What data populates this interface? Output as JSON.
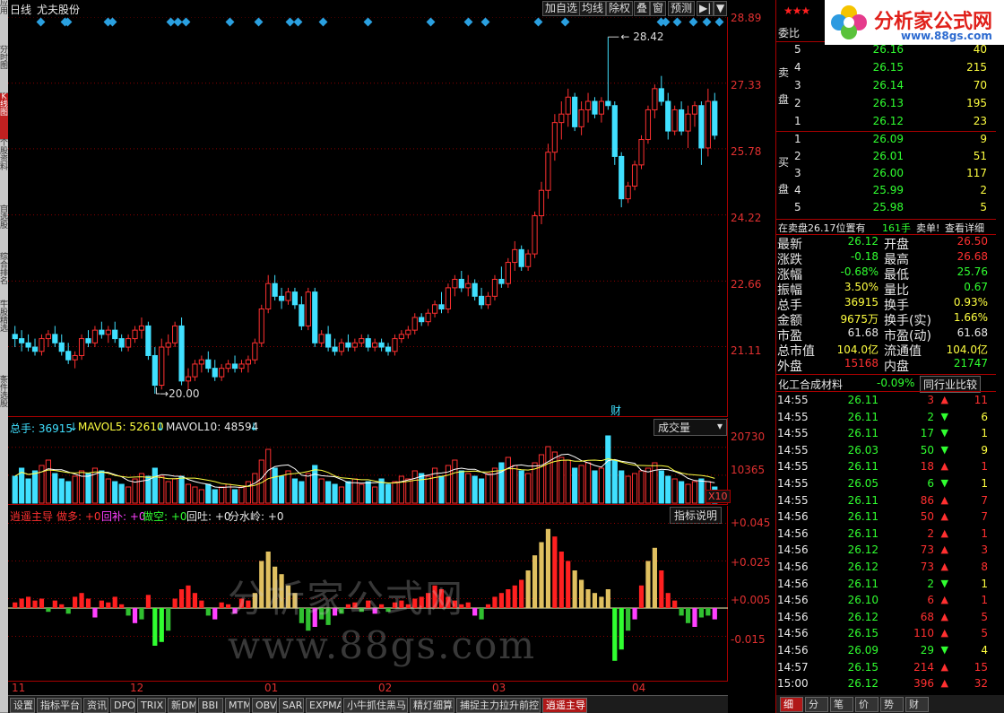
{
  "stock": {
    "period": "日线",
    "name": "尤夫股份"
  },
  "toolbar": {
    "add_fav": "加自选",
    "ma": "均线",
    "exright": "除权",
    "overlay": "叠",
    "window": "窗",
    "forecast": "预测"
  },
  "main": {
    "high_label": "28.42",
    "low_label": "20.00",
    "cai_label": "财",
    "yaxis": [
      "28.89",
      "27.33",
      "25.78",
      "24.22",
      "22.66",
      "21.11"
    ]
  },
  "volume": {
    "header_total": "总手: 36915",
    "header_ma5": "MAVOL5: 52610",
    "header_ma10": "MAVOL10: 48594",
    "selector": "成交量",
    "yaxis": [
      "20730",
      "10365"
    ],
    "unit": "X10"
  },
  "indicator": {
    "name": "逍遥主导",
    "do_more": "做多: +0",
    "hui_bu": "回补: +0",
    "do_short": "做空: +0",
    "hui_tu": "回吐: +0",
    "fen_shui": "分水岭: +0",
    "help": "指标说明",
    "yaxis": [
      "+0.045",
      "+0.025",
      "+0.005",
      "-0.015"
    ]
  },
  "xaxis": [
    "11",
    "12",
    "01",
    "02",
    "03",
    "04"
  ],
  "watermark": "分析家公式网www.88gs.com",
  "tabs": [
    "设置",
    "指标平台",
    "资讯",
    "DPO",
    "TRIX",
    "新DMA",
    "BBI",
    "MTM",
    "OBV",
    "SAR",
    "EXPMA",
    "小牛抓住黑马",
    "精灯细算",
    "捕捉主力拉升前控",
    "逍遥主导"
  ],
  "activeTab": "逍遥主导",
  "leftTabs": [
    "应用",
    "分时图",
    "K线图",
    "个股资料",
    "自选股",
    "综合排名",
    "牛股精选",
    "条件选股"
  ],
  "logo": {
    "text": "分析家公式网",
    "url": "www.88gs.com"
  },
  "orderbook": {
    "wei_bi": "委比",
    "sell_label": [
      "卖",
      "盘"
    ],
    "buy_label": [
      "买",
      "盘"
    ],
    "sells": [
      {
        "lvl": "5",
        "price": "26.16",
        "vol": "40"
      },
      {
        "lvl": "4",
        "price": "26.15",
        "vol": "215"
      },
      {
        "lvl": "3",
        "price": "26.14",
        "vol": "70"
      },
      {
        "lvl": "2",
        "price": "26.13",
        "vol": "195"
      },
      {
        "lvl": "1",
        "price": "26.12",
        "vol": "23"
      }
    ],
    "buys": [
      {
        "lvl": "1",
        "price": "26.09",
        "vol": "9"
      },
      {
        "lvl": "2",
        "price": "26.01",
        "vol": "51"
      },
      {
        "lvl": "3",
        "price": "26.00",
        "vol": "117"
      },
      {
        "lvl": "4",
        "price": "25.99",
        "vol": "2"
      },
      {
        "lvl": "5",
        "price": "25.98",
        "vol": "5"
      }
    ],
    "notice": "在卖盘26.17位置有",
    "notice_vol": "161手",
    "notice_sell": "卖单!",
    "notice_detail": "查看详细"
  },
  "quote": [
    {
      "l": "最新",
      "v": "26.12",
      "lc": "green",
      "r": "开盘",
      "rv": "26.50",
      "rc": "red"
    },
    {
      "l": "涨跌",
      "v": "-0.18",
      "lc": "green",
      "r": "最高",
      "rv": "26.68",
      "rc": "red"
    },
    {
      "l": "涨幅",
      "v": "-0.68%",
      "lc": "green",
      "r": "最低",
      "rv": "25.76",
      "rc": "green"
    },
    {
      "l": "振幅",
      "v": "3.50%",
      "lc": "yellow",
      "r": "量比",
      "rv": "0.67",
      "rc": "green"
    },
    {
      "l": "总手",
      "v": "36915",
      "lc": "yellow",
      "r": "换手",
      "rv": "0.93%",
      "rc": "yellow"
    },
    {
      "l": "金额",
      "v": "9675万",
      "lc": "yellow",
      "r": "换手(实)",
      "rv": "1.66%",
      "rc": "yellow"
    },
    {
      "l": "市盈",
      "v": "61.68",
      "lc": "white",
      "r": "市盈(动)",
      "rv": "61.68",
      "rc": "white"
    },
    {
      "l": "总市值",
      "v": "104.0亿",
      "lc": "yellow",
      "r": "流通值",
      "rv": "104.0亿",
      "rc": "yellow"
    },
    {
      "l": "外盘",
      "v": "15168",
      "lc": "red",
      "r": "内盘",
      "rv": "21747",
      "rc": "green"
    }
  ],
  "industry": {
    "name": "化工合成材料",
    "change": "-0.09%",
    "compare": "同行业比较"
  },
  "ticks": [
    {
      "t": "14:55",
      "p": "26.11",
      "v": "3",
      "d": "up",
      "x": "11"
    },
    {
      "t": "14:55",
      "p": "26.11",
      "v": "2",
      "d": "down",
      "x": "6"
    },
    {
      "t": "14:55",
      "p": "26.11",
      "v": "17",
      "d": "down",
      "x": "1"
    },
    {
      "t": "14:55",
      "p": "26.03",
      "v": "50",
      "d": "down",
      "x": "9"
    },
    {
      "t": "14:55",
      "p": "26.11",
      "v": "18",
      "d": "up",
      "x": "1"
    },
    {
      "t": "14:55",
      "p": "26.05",
      "v": "6",
      "d": "down",
      "x": "1"
    },
    {
      "t": "14:55",
      "p": "26.11",
      "v": "86",
      "d": "up",
      "x": "7"
    },
    {
      "t": "14:56",
      "p": "26.11",
      "v": "50",
      "d": "up",
      "x": "7"
    },
    {
      "t": "14:56",
      "p": "26.11",
      "v": "2",
      "d": "up",
      "x": "1"
    },
    {
      "t": "14:56",
      "p": "26.12",
      "v": "73",
      "d": "up",
      "x": "3"
    },
    {
      "t": "14:56",
      "p": "26.12",
      "v": "73",
      "d": "up",
      "x": "8"
    },
    {
      "t": "14:56",
      "p": "26.11",
      "v": "2",
      "d": "down",
      "x": "1"
    },
    {
      "t": "14:56",
      "p": "26.10",
      "v": "6",
      "d": "up",
      "x": "1"
    },
    {
      "t": "14:56",
      "p": "26.12",
      "v": "68",
      "d": "up",
      "x": "5"
    },
    {
      "t": "14:56",
      "p": "26.15",
      "v": "110",
      "d": "up",
      "x": "5"
    },
    {
      "t": "14:56",
      "p": "26.09",
      "v": "29",
      "d": "down",
      "x": "4"
    },
    {
      "t": "14:57",
      "p": "26.15",
      "v": "214",
      "d": "up",
      "x": "15"
    },
    {
      "t": "15:00",
      "p": "26.12",
      "v": "396",
      "d": "up",
      "x": "32"
    }
  ],
  "bottomTabs": [
    "细",
    "分",
    "笔",
    "价",
    "势",
    "财"
  ],
  "colors": {
    "up": "#ff3030",
    "down": "#40e0ff",
    "bg": "#000000",
    "grid": "#aa0000",
    "ma5": "#ffffff",
    "ma10": "#ffff40"
  },
  "chart_data": {
    "type": "candlestick",
    "ylim": [
      20.0,
      28.89
    ],
    "candles": [
      [
        21.4,
        21.6,
        21.1,
        21.3
      ],
      [
        21.3,
        21.5,
        21.0,
        21.2
      ],
      [
        21.2,
        21.4,
        21.0,
        21.1
      ],
      [
        21.1,
        21.3,
        20.9,
        21.0
      ],
      [
        21.0,
        21.4,
        20.9,
        21.3
      ],
      [
        21.3,
        21.5,
        21.1,
        21.4
      ],
      [
        21.4,
        21.6,
        21.1,
        21.2
      ],
      [
        21.2,
        21.4,
        20.9,
        21.0
      ],
      [
        21.0,
        21.2,
        20.7,
        20.8
      ],
      [
        20.8,
        21.0,
        20.6,
        20.9
      ],
      [
        20.9,
        21.4,
        20.8,
        21.3
      ],
      [
        21.3,
        21.5,
        21.1,
        21.2
      ],
      [
        21.2,
        21.6,
        21.1,
        21.5
      ],
      [
        21.5,
        21.7,
        21.3,
        21.4
      ],
      [
        21.4,
        21.6,
        21.2,
        21.5
      ],
      [
        21.5,
        21.7,
        21.2,
        21.3
      ],
      [
        21.3,
        21.4,
        21.0,
        21.1
      ],
      [
        21.1,
        21.4,
        21.0,
        21.3
      ],
      [
        21.3,
        21.6,
        21.2,
        21.5
      ],
      [
        21.5,
        21.8,
        21.3,
        21.6
      ],
      [
        21.6,
        21.7,
        20.8,
        20.9
      ],
      [
        20.9,
        21.1,
        20.0,
        20.2
      ],
      [
        20.2,
        21.3,
        20.1,
        21.1
      ],
      [
        21.1,
        21.4,
        20.9,
        21.2
      ],
      [
        21.2,
        21.7,
        21.1,
        21.6
      ],
      [
        21.6,
        21.8,
        20.2,
        20.3
      ],
      [
        20.3,
        20.6,
        20.1,
        20.4
      ],
      [
        20.4,
        20.8,
        20.3,
        20.7
      ],
      [
        20.7,
        20.9,
        20.5,
        20.8
      ],
      [
        20.8,
        21.0,
        20.5,
        20.6
      ],
      [
        20.6,
        20.8,
        20.3,
        20.4
      ],
      [
        20.4,
        20.7,
        20.3,
        20.6
      ],
      [
        20.6,
        20.8,
        20.5,
        20.7
      ],
      [
        20.7,
        20.9,
        20.5,
        20.6
      ],
      [
        20.6,
        20.8,
        20.5,
        20.7
      ],
      [
        20.7,
        20.9,
        20.5,
        20.8
      ],
      [
        20.8,
        21.3,
        20.7,
        21.2
      ],
      [
        21.2,
        22.1,
        21.1,
        22.0
      ],
      [
        22.0,
        22.8,
        21.9,
        22.6
      ],
      [
        22.6,
        22.8,
        22.2,
        22.3
      ],
      [
        22.3,
        22.5,
        22.0,
        22.2
      ],
      [
        22.2,
        22.5,
        22.1,
        22.4
      ],
      [
        22.4,
        22.5,
        22.0,
        22.1
      ],
      [
        22.1,
        22.3,
        21.5,
        21.6
      ],
      [
        21.6,
        22.5,
        21.5,
        22.4
      ],
      [
        22.4,
        22.5,
        21.1,
        21.2
      ],
      [
        21.2,
        21.5,
        21.1,
        21.4
      ],
      [
        21.4,
        21.6,
        21.0,
        21.1
      ],
      [
        21.1,
        21.3,
        20.9,
        21.0
      ],
      [
        21.0,
        21.3,
        20.9,
        21.2
      ],
      [
        21.2,
        21.4,
        21.0,
        21.1
      ],
      [
        21.1,
        21.3,
        21.0,
        21.2
      ],
      [
        21.2,
        21.4,
        21.1,
        21.3
      ],
      [
        21.3,
        21.4,
        21.0,
        21.1
      ],
      [
        21.1,
        21.3,
        21.0,
        21.2
      ],
      [
        21.2,
        21.3,
        21.0,
        21.1
      ],
      [
        21.1,
        21.2,
        20.9,
        21.0
      ],
      [
        21.0,
        21.4,
        20.9,
        21.3
      ],
      [
        21.3,
        21.5,
        21.2,
        21.4
      ],
      [
        21.4,
        21.6,
        21.3,
        21.5
      ],
      [
        21.5,
        21.9,
        21.4,
        21.8
      ],
      [
        21.8,
        21.9,
        21.6,
        21.7
      ],
      [
        21.7,
        22.0,
        21.6,
        21.9
      ],
      [
        21.9,
        22.2,
        21.8,
        22.1
      ],
      [
        22.1,
        22.4,
        21.9,
        22.0
      ],
      [
        22.0,
        22.6,
        21.9,
        22.5
      ],
      [
        22.5,
        22.8,
        22.3,
        22.7
      ],
      [
        22.7,
        22.9,
        22.4,
        22.5
      ],
      [
        22.5,
        22.8,
        22.3,
        22.6
      ],
      [
        22.6,
        22.7,
        22.2,
        22.3
      ],
      [
        22.3,
        22.5,
        22.0,
        22.1
      ],
      [
        22.1,
        22.4,
        22.0,
        22.3
      ],
      [
        22.3,
        22.8,
        22.2,
        22.7
      ],
      [
        22.7,
        23.0,
        22.5,
        22.6
      ],
      [
        22.6,
        23.2,
        22.5,
        23.1
      ],
      [
        23.1,
        23.6,
        22.9,
        23.4
      ],
      [
        23.4,
        23.5,
        22.9,
        23.0
      ],
      [
        23.0,
        23.4,
        22.9,
        23.3
      ],
      [
        23.3,
        24.3,
        23.2,
        24.2
      ],
      [
        24.2,
        25.0,
        24.0,
        24.8
      ],
      [
        24.8,
        25.9,
        24.6,
        25.7
      ],
      [
        25.7,
        26.6,
        25.5,
        26.4
      ],
      [
        26.4,
        26.9,
        26.0,
        26.6
      ],
      [
        26.6,
        27.2,
        26.3,
        27.0
      ],
      [
        27.0,
        27.1,
        26.2,
        26.3
      ],
      [
        26.3,
        26.9,
        26.1,
        26.7
      ],
      [
        26.7,
        27.1,
        26.4,
        26.9
      ],
      [
        26.9,
        27.0,
        26.5,
        26.6
      ],
      [
        26.6,
        27.0,
        26.4,
        26.9
      ],
      [
        26.9,
        28.42,
        26.7,
        26.8
      ],
      [
        26.8,
        26.9,
        25.4,
        25.6
      ],
      [
        25.6,
        25.7,
        24.4,
        24.6
      ],
      [
        24.6,
        25.0,
        24.5,
        24.9
      ],
      [
        24.9,
        25.5,
        24.8,
        25.4
      ],
      [
        25.4,
        26.1,
        25.3,
        26.0
      ],
      [
        26.0,
        26.8,
        25.9,
        26.7
      ],
      [
        26.7,
        27.3,
        26.5,
        27.2
      ],
      [
        27.2,
        27.5,
        26.8,
        26.9
      ],
      [
        26.9,
        27.1,
        26.0,
        26.2
      ],
      [
        26.2,
        26.8,
        26.1,
        26.7
      ],
      [
        26.7,
        26.9,
        26.1,
        26.2
      ],
      [
        26.2,
        26.8,
        25.8,
        26.6
      ],
      [
        26.6,
        26.9,
        26.3,
        26.8
      ],
      [
        26.8,
        26.9,
        25.4,
        25.8
      ],
      [
        25.8,
        27.2,
        25.6,
        26.9
      ],
      [
        26.9,
        27.1,
        26.0,
        26.1
      ]
    ],
    "volumes": [
      10,
      13,
      9,
      12,
      14,
      16,
      11,
      9,
      8,
      10,
      12,
      11,
      13,
      12,
      9,
      8,
      7,
      6,
      9,
      11,
      10,
      13,
      10,
      8,
      9,
      10,
      7,
      6,
      5,
      7,
      5,
      6,
      7,
      5,
      6,
      8,
      11,
      16,
      20,
      13,
      10,
      12,
      9,
      8,
      11,
      14,
      9,
      8,
      7,
      6,
      8,
      9,
      7,
      8,
      6,
      9,
      7,
      8,
      10,
      9,
      12,
      11,
      10,
      13,
      10,
      14,
      16,
      12,
      11,
      10,
      9,
      11,
      13,
      15,
      17,
      14,
      12,
      11,
      15,
      18,
      21,
      19,
      17,
      16,
      13,
      14,
      15,
      12,
      13,
      25,
      16,
      12,
      10,
      11,
      12,
      13,
      15,
      12,
      10,
      9,
      8,
      7,
      8,
      9,
      8,
      6
    ],
    "indicator": [
      0.003,
      0.005,
      0.006,
      0.004,
      0.005,
      -0.002,
      0.004,
      0.002,
      -0.003,
      0.006,
      0.008,
      0.005,
      -0.005,
      0.004,
      0.003,
      0.006,
      0.002,
      -0.004,
      -0.008,
      -0.006,
      0.007,
      -0.02,
      -0.018,
      -0.012,
      0.005,
      0.01,
      0.012,
      0.008,
      0.004,
      -0.004,
      -0.006,
      0.003,
      0.002,
      -0.003,
      0.005,
      0.004,
      0.008,
      0.025,
      0.03,
      0.022,
      0.018,
      0.012,
      0.008,
      -0.008,
      -0.012,
      -0.01,
      -0.006,
      -0.009,
      -0.004,
      -0.003,
      0.002,
      0.003,
      -0.002,
      0.004,
      -0.003,
      0.002,
      -0.002,
      0.003,
      0.004,
      0.002,
      0.005,
      0.006,
      0.008,
      0.012,
      0.01,
      0.006,
      0.004,
      0.002,
      0.003,
      -0.004,
      -0.006,
      0.002,
      0.006,
      0.008,
      0.01,
      0.012,
      0.015,
      0.02,
      0.028,
      0.035,
      0.042,
      0.038,
      0.03,
      0.025,
      0.02,
      0.015,
      0.01,
      0.008,
      0.006,
      0.01,
      -0.028,
      -0.022,
      -0.012,
      -0.006,
      0.012,
      0.025,
      0.032,
      0.02,
      0.008,
      0.004,
      -0.004,
      -0.008,
      -0.01,
      -0.005,
      -0.004,
      -0.006
    ]
  }
}
